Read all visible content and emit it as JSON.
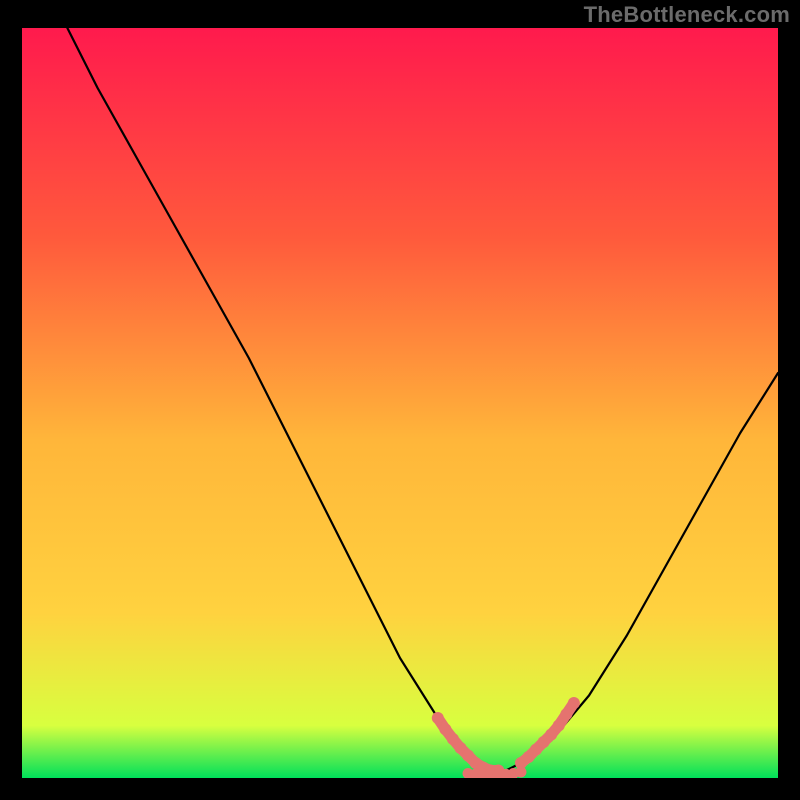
{
  "watermark": "TheBottleneck.com",
  "chart_data": {
    "type": "line",
    "title": "",
    "xlabel": "",
    "ylabel": "",
    "xlim": [
      0,
      100
    ],
    "ylim": [
      0,
      100
    ],
    "grid": false,
    "legend": false,
    "background_gradient": {
      "top": "#ff1a4d",
      "mid": "#ffd23f",
      "bottom": "#00e05a"
    },
    "series": [
      {
        "name": "curve",
        "stroke": "#000000",
        "x": [
          6,
          10,
          15,
          20,
          25,
          30,
          35,
          40,
          45,
          50,
          55,
          58,
          60,
          62,
          64,
          66,
          70,
          75,
          80,
          85,
          90,
          95,
          100
        ],
        "y": [
          100,
          92,
          83,
          74,
          65,
          56,
          46,
          36,
          26,
          16,
          8,
          4,
          2,
          1,
          1,
          2,
          5,
          11,
          19,
          28,
          37,
          46,
          54
        ]
      },
      {
        "name": "highlight-left",
        "stroke": "#e5736f",
        "thick": true,
        "x": [
          55,
          56,
          57,
          58,
          59,
          60,
          61,
          62,
          63
        ],
        "y": [
          8,
          6.5,
          5.2,
          4,
          3,
          2,
          1.4,
          1,
          1
        ]
      },
      {
        "name": "highlight-right",
        "stroke": "#e5736f",
        "thick": true,
        "x": [
          66,
          67,
          68,
          69,
          70,
          71,
          72,
          73
        ],
        "y": [
          2,
          2.8,
          3.8,
          4.8,
          5.8,
          7,
          8.5,
          10
        ]
      },
      {
        "name": "bottom-dots",
        "stroke": "#e5736f",
        "dots": true,
        "x": [
          59,
          60,
          61,
          62,
          63,
          64,
          65,
          66
        ],
        "y": [
          0.6,
          0.5,
          0.5,
          0.5,
          0.5,
          0.5,
          0.6,
          0.8
        ]
      }
    ]
  }
}
